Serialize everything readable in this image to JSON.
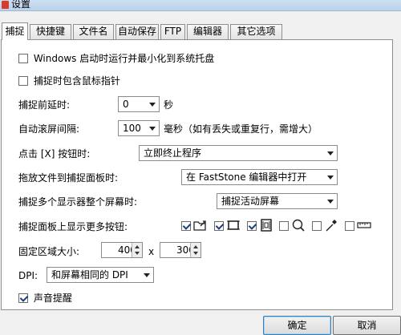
{
  "window": {
    "title": "设置"
  },
  "tabs": [
    "捕捉",
    "快捷键",
    "文件名",
    "自动保存",
    "FTP",
    "编辑器",
    "其它选项"
  ],
  "options": {
    "startup_minimize": "Windows 启动时运行并最小化到系统托盘",
    "include_cursor": "捕捉时包含鼠标指针",
    "capture_delay": {
      "label": "捕捉前延时:",
      "value": "0",
      "unit": "秒"
    },
    "scroll_interval": {
      "label": "自动滚屏间隔:",
      "value": "100",
      "unit": "毫秒（如有丢失或重复行，需增大）"
    },
    "x_button": {
      "label": "点击 [X] 按钮时:",
      "value": "立即终止程序"
    },
    "drag_file": {
      "label": "拖放文件到捕捉面板时:",
      "value": "在 FastStone 编辑器中打开"
    },
    "multi_monitor": {
      "label": "捕捉多个显示器整个屏幕时:",
      "value": "捕捉活动屏幕"
    },
    "more_buttons": {
      "label": "捕捉面板上显示更多按钮:"
    },
    "fixed_size": {
      "label": "固定区域大小:",
      "width": "400",
      "separator": "x",
      "height": "300"
    },
    "dpi": {
      "label": "DPI:",
      "value": "和屏幕相同的 DPI"
    },
    "sound": "声音提醒"
  },
  "extra_buttons": [
    {
      "icon": "open-folder-icon",
      "checked": true
    },
    {
      "icon": "rectangle-region-icon",
      "checked": true
    },
    {
      "icon": "film-strip-icon",
      "checked": true
    },
    {
      "icon": "magnifier-icon",
      "checked": false
    },
    {
      "icon": "color-picker-icon",
      "checked": false
    },
    {
      "icon": "ruler-icon",
      "checked": false
    }
  ],
  "footer": {
    "ok": "确定",
    "cancel": "取消"
  }
}
